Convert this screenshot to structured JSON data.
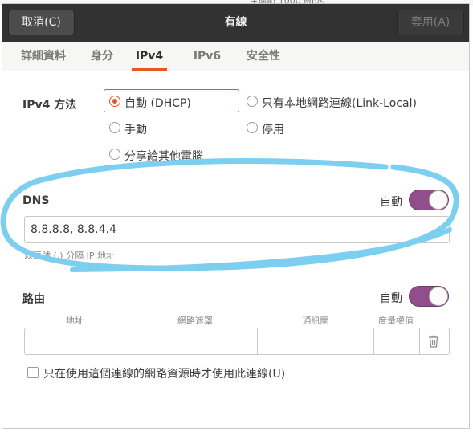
{
  "background_window": {
    "partial_text": "+速組 1000 Mb/s"
  },
  "headerbar": {
    "cancel_label": "取消(C)",
    "title": "有線",
    "apply_label": "套用(A)"
  },
  "tabs": [
    {
      "label": "詳細資料",
      "active": false
    },
    {
      "label": "身分",
      "active": false
    },
    {
      "label": "IPv4",
      "active": true
    },
    {
      "label": "IPv6",
      "active": false
    },
    {
      "label": "安全性",
      "active": false
    }
  ],
  "ipv4_method": {
    "label": "IPv4 方法",
    "options": [
      {
        "label": "自動 (DHCP)",
        "checked": true
      },
      {
        "label": "只有本地網路連線(Link-Local)",
        "checked": false
      },
      {
        "label": "手動",
        "checked": false
      },
      {
        "label": "停用",
        "checked": false
      },
      {
        "label": "分享給其他電腦",
        "checked": false
      }
    ]
  },
  "dns": {
    "label": "DNS",
    "auto_label": "自動",
    "auto_enabled": true,
    "value": "8.8.8.8, 8.8.4.4",
    "hint": "以逗號 (,) 分隔 IP 地址"
  },
  "routes": {
    "label": "路由",
    "auto_label": "自動",
    "auto_enabled": true,
    "columns": [
      "地址",
      "網路遮罩",
      "通訊閘",
      "度量權值"
    ]
  },
  "only_for_resources": {
    "label": "只在使用這個連線的網路資源時才使用此連線(U)",
    "checked": false
  },
  "colors": {
    "accent": "#e95420",
    "switch_on": "#924d8b",
    "headerbar": "#323232",
    "annotation_stroke": "#7dcff0"
  }
}
